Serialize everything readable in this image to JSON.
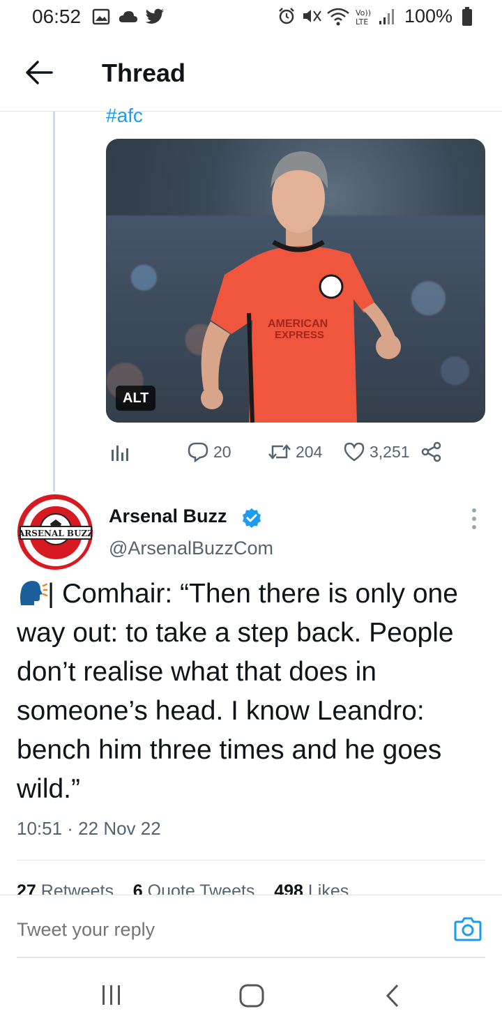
{
  "status_bar": {
    "time": "06:52",
    "battery_percent": "100%",
    "left_icons": [
      "gallery-icon",
      "cloud-icon",
      "twitter-icon"
    ],
    "right_icons": [
      "alarm-icon",
      "mute-icon",
      "wifi-icon",
      "volte-icon",
      "signal-icon",
      "battery-icon"
    ]
  },
  "header": {
    "title": "Thread",
    "back_icon": "arrow-left-icon"
  },
  "previous_tweet": {
    "hashtag": "#afc",
    "image_alt_badge": "ALT",
    "actions": {
      "replies": "20",
      "retweets": "204",
      "likes": "3,251"
    },
    "action_icons": [
      "analytics-icon",
      "reply-icon",
      "retweet-icon",
      "like-icon",
      "share-icon"
    ]
  },
  "main_tweet": {
    "author_name": "Arsenal Buzz",
    "author_handle": "@ArsenalBuzzCom",
    "avatar_text": "ARSENAL BUZZ",
    "text": "| Comhair: “Then there is only one way out: to take a step back. People don’t realise what that does in someone’s head. I know Leandro: bench him three times and he goes wild.”",
    "timestamp": "10:51 · 22 Nov 22",
    "counts": {
      "retweets_value": "27",
      "retweets_label": "Retweets",
      "quotes_value": "6",
      "quotes_label": "Quote Tweets",
      "likes_value": "498",
      "likes_label": "Likes"
    },
    "colors": {
      "accent": "#1d9bf0",
      "text": "#0f1419",
      "secondary": "#536471"
    }
  },
  "reply_bar": {
    "placeholder": "Tweet your reply",
    "camera_icon": "camera-icon"
  },
  "nav_bar": {
    "icons": [
      "recent-apps-icon",
      "home-icon",
      "back-icon"
    ]
  }
}
